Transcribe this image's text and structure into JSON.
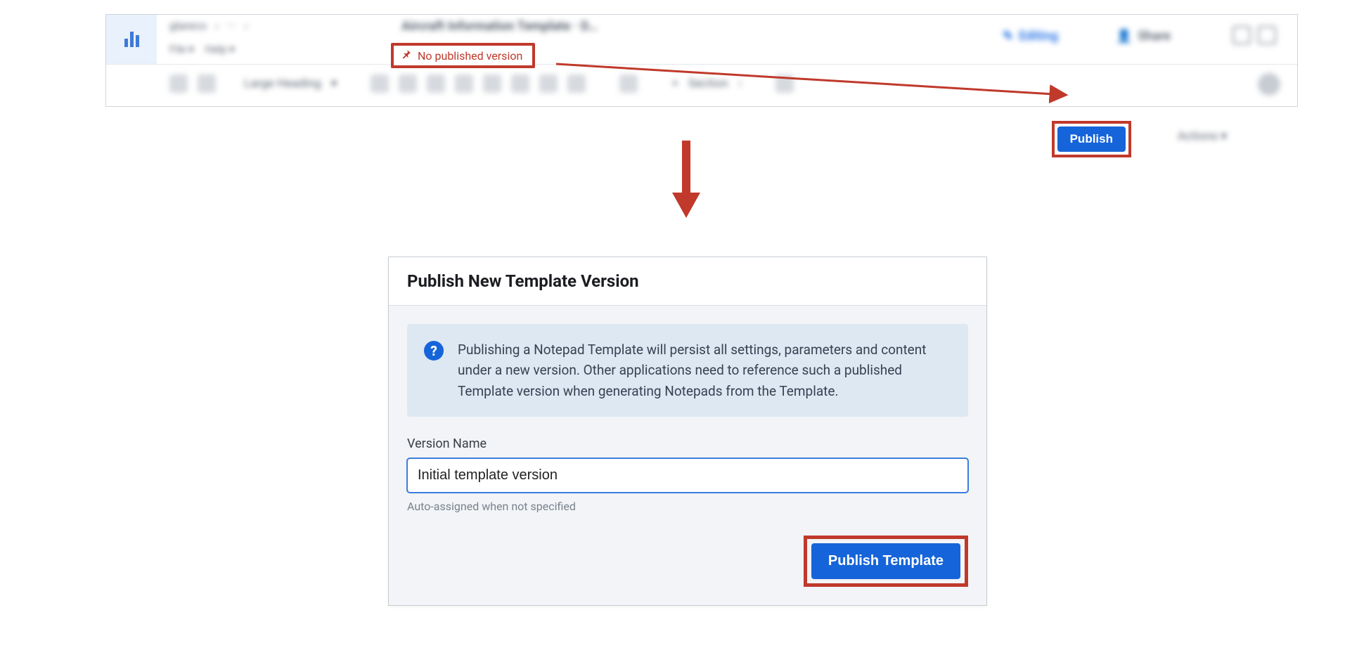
{
  "colors": {
    "accent": "#1664d9",
    "highlight": "#c0392b"
  },
  "appbar": {
    "breadcrumb_user": "glareco",
    "breadcrumb_sep": "›",
    "breadcrumb_more": "···",
    "title": "Aircraft Information Template · D…",
    "menu_file": "File ▾",
    "menu_help": "Help ▾",
    "editing_label": "Editing",
    "share_label": "Share",
    "no_published_label": "No published version",
    "pin_icon_name": "pin-icon"
  },
  "toolbar": {
    "style_label": "Large Heading",
    "section_label": "Section",
    "publish_label": "Publish",
    "actions_label": "Actions ▾"
  },
  "dialog": {
    "title": "Publish New Template Version",
    "callout": "Publishing a Notepad Template will persist all settings, parameters and content under a new version. Other applications need to reference such a published Template version when generating Notepads from the Template.",
    "field_label": "Version Name",
    "input_value": "Initial template version",
    "helper": "Auto-assigned when not specified",
    "submit_label": "Publish Template",
    "help_icon_glyph": "?"
  }
}
